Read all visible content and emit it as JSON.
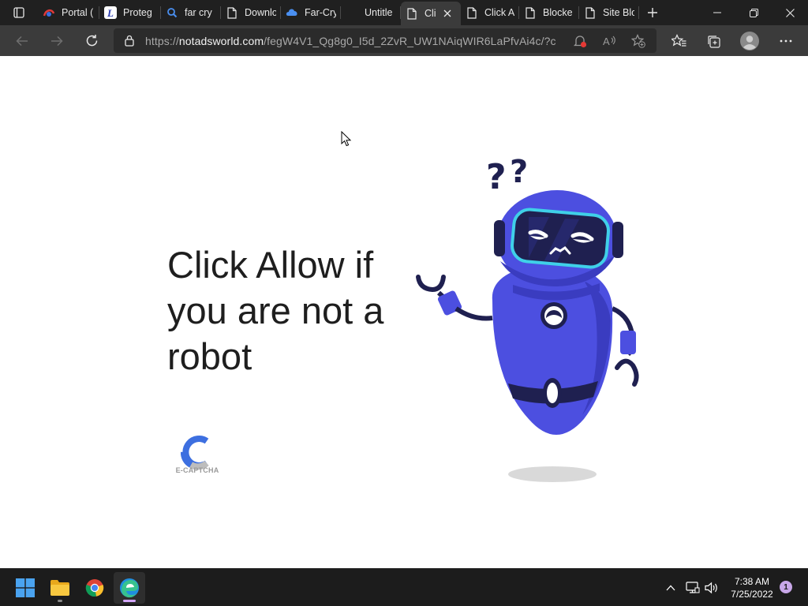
{
  "browser": {
    "tabs": [
      {
        "label": "Portal (",
        "icon": "portal-favicon"
      },
      {
        "label": "Proteg",
        "icon": "protegent-favicon"
      },
      {
        "label": "far cry",
        "icon": "search-icon"
      },
      {
        "label": "Downlo",
        "icon": "page-icon"
      },
      {
        "label": "Far-Cry",
        "icon": "cloud-icon"
      },
      {
        "label": "Untitle",
        "icon": "none"
      },
      {
        "label": "Cli",
        "icon": "page-icon",
        "active": true
      },
      {
        "label": "Click A",
        "icon": "page-icon"
      },
      {
        "label": "Blocke",
        "icon": "page-icon"
      },
      {
        "label": "Site Blo",
        "icon": "page-icon"
      }
    ],
    "url_prefix": "https://",
    "url_domain": "notadsworld.com",
    "url_path": "/fegW4V1_Qg8g0_I5d_2ZvR_UW1NAiqWIR6LaPfvAi4c/?ci..."
  },
  "page": {
    "headline": "Click Allow if you are not a robot",
    "captcha_label": "E-CAPTCHA"
  },
  "taskbar": {
    "time": "7:38 AM",
    "date": "7/25/2022",
    "notification_count": "1"
  },
  "colors": {
    "robot_body": "#4c4fe0",
    "robot_dark": "#1f2050",
    "visor_glow": "#3fd0e8",
    "edge_accent": "#d4a7ff"
  }
}
